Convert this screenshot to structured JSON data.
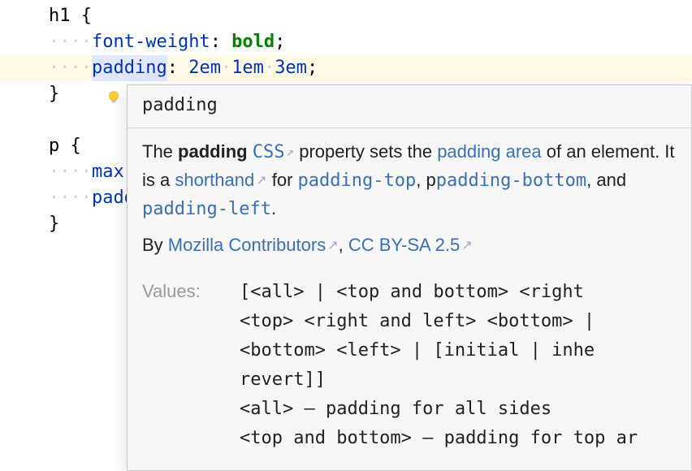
{
  "code": {
    "line1_selector": "h1",
    "line1_brace": " {",
    "line2_prop": "font-weight",
    "line2_colon": ":",
    "line2_value": " bold",
    "line2_semicolon": ";",
    "line3_prop": "padding",
    "line3_colon": ":",
    "line3_v1": " 2em",
    "line3_sp1": " ",
    "line3_v2": "1em",
    "line3_sp2": " ",
    "line3_v3": "3em",
    "line3_semicolon": ";",
    "line4_brace": "}",
    "line6_selector": "p",
    "line6_brace": " {",
    "line7_prop": "max-w",
    "line8_prop": "paddi",
    "line9_brace": "}"
  },
  "popup": {
    "title": "padding",
    "p1_pre": "The ",
    "p1_strong": "padding",
    "p1_sp": " ",
    "p1_link_css": "CSS",
    "p1_mid": " property sets the ",
    "p1_link_area": "padding area",
    "p1_after": " of an element. It is a ",
    "p1_link_shorthand": "shorthand",
    "p1_for": " for ",
    "p1_link_pt": "padding-top",
    "p1_comma1": ", p",
    "p1_link_pb": "padding-bottom",
    "p1_comma2": ", and ",
    "p1_link_pl": "padding-left",
    "p1_period": ".",
    "p2_by": "By ",
    "p2_link_moz": "Mozilla Contributors",
    "p2_comma": ", ",
    "p2_link_cc": "CC BY-SA 2.5",
    "values_label": "Values:",
    "values_text": "[<all> | <top and bottom> <right \n<top> <right and left> <bottom> | \n<bottom> <left> | [initial | inhe\nrevert]]\n<all> – padding for all sides\n<top and bottom> – padding for top ar"
  }
}
